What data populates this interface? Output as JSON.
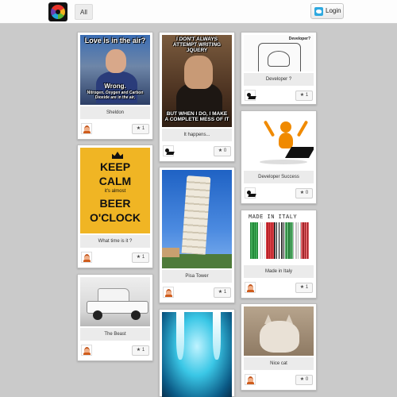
{
  "header": {
    "nav_all": "All",
    "login_label": "Login"
  },
  "colors": {
    "page_bg": "#cacaca",
    "caption_bg": "#ebebeb",
    "twitter_blue": "#2fa9e0"
  },
  "cards": {
    "sheldon": {
      "caption": "Sheldon",
      "count": "1",
      "meme_top": "Love is in the air?",
      "meme_mid": "Wrong.",
      "meme_bottom": "Nitrogen, Oxygen and Carbon Dioxide are in the air."
    },
    "it_happens": {
      "caption": "It happens...",
      "count": "0",
      "meme_top": "I DON'T ALWAYS ATTEMPT WRITING JQUERY",
      "meme_bottom": "BUT WHEN I DO, I MAKE A COMPLETE MESS OF IT"
    },
    "developer": {
      "caption": "Developer ?",
      "count": "1",
      "sketch_label": "Developer?"
    },
    "keep_calm": {
      "caption": "What time is it ?",
      "count": "1",
      "line1": "KEEP",
      "line2": "CALM",
      "line3": "it's almost",
      "line4": "BEER",
      "line5": "O'CLOCK"
    },
    "dev_success": {
      "caption": "Developer Success",
      "count": "0"
    },
    "pisa": {
      "caption": "Pisa Tower",
      "count": "1"
    },
    "made_in_italy": {
      "caption": "Made in Italy",
      "count": "1",
      "barcode_text": "MADE IN ITALY"
    },
    "beast": {
      "caption": "The Beast",
      "count": "1"
    },
    "nice_cat": {
      "caption": "Nice cat",
      "count": "0"
    }
  },
  "icons": {
    "star": "★"
  }
}
